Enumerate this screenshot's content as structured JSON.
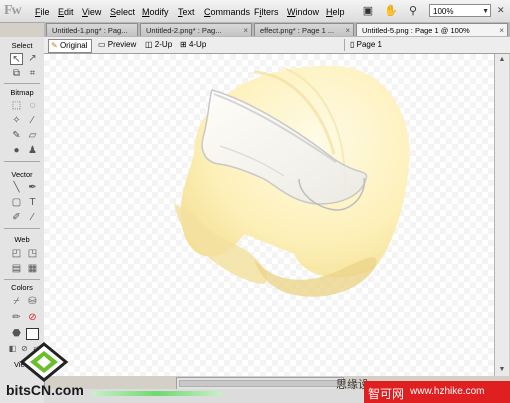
{
  "app": {
    "logo": "Fw"
  },
  "menu": [
    {
      "label": "File",
      "key": "F",
      "rest": "ile"
    },
    {
      "label": "Edit",
      "key": "E",
      "rest": "dit"
    },
    {
      "label": "View",
      "key": "V",
      "rest": "iew"
    },
    {
      "label": "Select",
      "key": "S",
      "rest": "elect"
    },
    {
      "label": "Modify",
      "key": "M",
      "rest": "odify"
    },
    {
      "label": "Text",
      "key": "T",
      "rest": "ext"
    },
    {
      "label": "Commands",
      "key": "C",
      "rest": "ommands"
    },
    {
      "label": "Filters",
      "key": "i",
      "pre": "F",
      "rest": "lters"
    },
    {
      "label": "Window",
      "key": "W",
      "rest": "indow"
    },
    {
      "label": "Help",
      "key": "H",
      "rest": "elp"
    }
  ],
  "toolbar": {
    "zoom": "100%"
  },
  "tabs": [
    {
      "label": "Untitled-1.png* : Pag..."
    },
    {
      "label": "Untitled-2.png* : Pag..."
    },
    {
      "label": "effect.png* : Page 1 ..."
    },
    {
      "label": "Untitled-5.png : Page 1 @ 100%"
    }
  ],
  "tools": {
    "select": "Select",
    "bitmap": "Bitmap",
    "vector": "Vector",
    "web": "Web",
    "colors": "Colors",
    "view": "View"
  },
  "viewbar": {
    "original": "Original",
    "preview": "Preview",
    "two_up": "2-Up",
    "four_up": "4-Up",
    "page": "Page 1"
  },
  "overlay": {
    "cn_text": "思缘设",
    "watermark_zh": "智可网",
    "watermark_url": "www.hzhike.com",
    "site_logo": "bitsCN.com"
  },
  "colors": {
    "accent": "#e02020",
    "canvas": "#ffffff"
  }
}
